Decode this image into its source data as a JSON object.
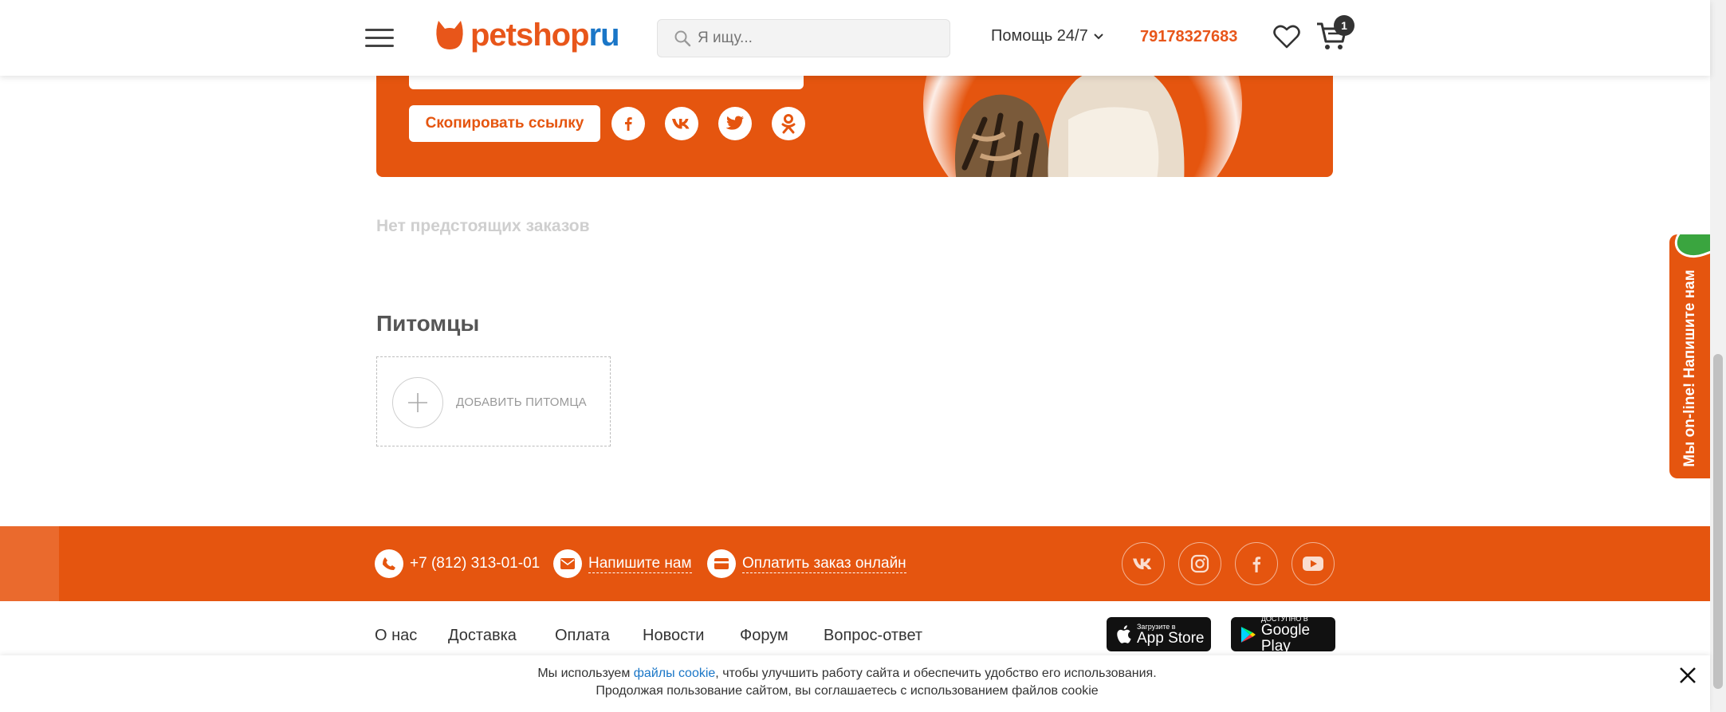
{
  "header": {
    "logo_main": "petshop",
    "logo_accent": "ru",
    "search_placeholder": "Я ищу...",
    "help_label": "Помощь 24/7",
    "phone": "79178327683",
    "cart_count": "1",
    "icons": [
      "menu-icon",
      "search-icon",
      "chevron-down-icon",
      "heart-icon",
      "cart-icon"
    ]
  },
  "banner": {
    "copy_button": "Скопировать ссылку",
    "share_icons": [
      "facebook-icon",
      "vk-icon",
      "twitter-icon",
      "odnoklassniki-icon"
    ]
  },
  "orders": {
    "empty_text": "Нет предстоящих заказов"
  },
  "pets": {
    "title": "Питомцы",
    "add_label": "ДОБАВИТЬ ПИТОМЦА"
  },
  "chat_tab": {
    "label": "Мы on-line! Напишите нам"
  },
  "footer_bar": {
    "phone": "+7 (812) 313-01-01",
    "write_us": "Напишите нам",
    "pay_online": "Оплатить заказ онлайн",
    "social_icons": [
      "vk-icon",
      "instagram-icon",
      "facebook-icon",
      "youtube-icon"
    ]
  },
  "footer_nav": {
    "items": [
      "О нас",
      "Доставка",
      "Оплата",
      "Новости",
      "Форум",
      "Вопрос-ответ"
    ],
    "app_store_small": "Загрузите в",
    "app_store_big": "App Store",
    "google_play_small": "ДОСТУПНО В",
    "google_play_big": "Google Play"
  },
  "cookie": {
    "prefix": "Мы используем ",
    "link": "файлы cookie",
    "suffix": ", чтобы улучшить работу сайта и обеспечить удобство его использования.",
    "line2": "Продолжая пользование сайтом, вы соглашаетесь с использованием файлов cookie"
  },
  "colors": {
    "brand_orange": "#e5550f",
    "brand_blue": "#1a76c7",
    "chat_green": "#3aa53f"
  }
}
